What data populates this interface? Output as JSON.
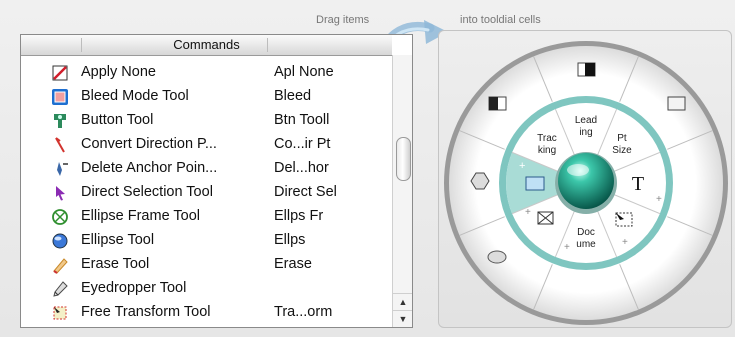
{
  "hints": {
    "left": "Drag items",
    "right": "into tooldial cells"
  },
  "commands": {
    "header": "Commands",
    "rows": [
      {
        "name": "Apply None",
        "abbr": "Apl None",
        "icon": "apply-none-icon",
        "color": "#d21d2b"
      },
      {
        "name": "Bleed Mode Tool",
        "abbr": "Bleed",
        "icon": "bleed-mode-icon",
        "color": "#1f6fd0"
      },
      {
        "name": "Button Tool",
        "abbr": "Btn Tooll",
        "icon": "button-tool-icon",
        "color": "#2c8a5c"
      },
      {
        "name": "Convert Direction P...",
        "abbr": "Co...ir Pt",
        "icon": "convert-direction-icon",
        "color": "#d2332e"
      },
      {
        "name": "Delete Anchor Poin...",
        "abbr": "Del...hor",
        "icon": "delete-anchor-icon",
        "color": "#3a67a8"
      },
      {
        "name": "Direct Selection Tool",
        "abbr": "Direct Sel",
        "icon": "direct-selection-icon",
        "color": "#8b2bb3"
      },
      {
        "name": "Ellipse Frame Tool",
        "abbr": "Ellps Fr",
        "icon": "ellipse-frame-icon",
        "color": "#2f8f2f"
      },
      {
        "name": "Ellipse Tool",
        "abbr": "Ellps",
        "icon": "ellipse-tool-icon",
        "color": "#3b78d8"
      },
      {
        "name": "Erase Tool",
        "abbr": "Erase",
        "icon": "erase-tool-icon",
        "color": "#c98a2a"
      },
      {
        "name": "Eyedropper Tool",
        "abbr": "",
        "icon": "eyedropper-icon",
        "color": "#4a4a4a"
      },
      {
        "name": "Free Transform Tool",
        "abbr": "Tra...orm",
        "icon": "free-transform-icon",
        "color": "#d2332e"
      }
    ]
  },
  "dial": {
    "cells": [
      {
        "label": "Lead\ning"
      },
      {
        "label": "Pt\nSize"
      },
      {
        "label": "Doc\nume"
      },
      {
        "label": "Trac\nking"
      }
    ],
    "accent": "#7fc6c0",
    "center_color": "#149a86"
  }
}
